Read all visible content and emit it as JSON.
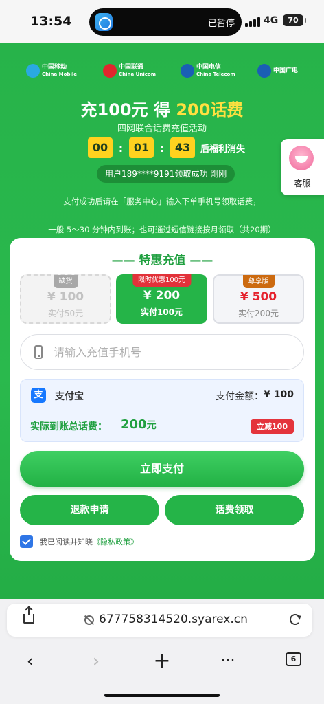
{
  "status_bar": {
    "time": "13:54",
    "island_text": "已暂停",
    "network": "4G",
    "battery": "70"
  },
  "carriers": [
    {
      "name": "中国移动",
      "sub": "China Mobile",
      "color": "#2aa9e0"
    },
    {
      "name": "中国联通",
      "sub": "China Unicom",
      "color": "#e0262d"
    },
    {
      "name": "中国电信",
      "sub": "China Telecom",
      "color": "#1a5fb4"
    },
    {
      "name": "中国广电",
      "sub": "",
      "color": "#1a5fb4"
    }
  ],
  "hero": {
    "headline_prefix": "充100元 得 ",
    "headline_highlight": "200话费",
    "subtitle": "—— 四网联合话费充值活动 ——",
    "countdown": [
      "00",
      "01",
      "43"
    ],
    "countdown_sep": ":",
    "countdown_label": "后福利消失",
    "winner": "用户189****9191领取成功 刚刚",
    "notice1": "支付成功后请在「服务中心」输入下单手机号领取话费，",
    "notice2": "一般 5～30 分钟内到账；也可通过短信链接按月领取（共20期）"
  },
  "side": {
    "service_label": "客服"
  },
  "card": {
    "title": "—— 特惠充值 ——",
    "options": [
      {
        "tag": "缺货",
        "price": "¥ 100",
        "sub": "实付50元"
      },
      {
        "tag": "限时优惠100元",
        "price": "¥ 200",
        "sub": "实付100元"
      },
      {
        "tag": "尊享版",
        "price": "¥ 500",
        "sub": "实付200元"
      }
    ],
    "phone_placeholder": "请输入充值手机号",
    "payment": {
      "method": "支付宝",
      "method_icon_text": "支",
      "amount_label": "支付金额：",
      "amount": "¥ 100",
      "actual_label": "实际到账总话费：",
      "actual_amount": "200",
      "actual_unit": "元",
      "discount": "立减100"
    },
    "pay_button": "立即支付",
    "refund_button": "退款申请",
    "claim_button": "话费领取",
    "agree_text": "我已阅读并知晓",
    "agree_link": "《隐私政策》"
  },
  "browser": {
    "url": "677758314520.syarex.cn",
    "tab_count": "6",
    "back": "‹",
    "forward": "›",
    "add": "+",
    "more": "···"
  },
  "colors": {
    "brand_green": "#25b448",
    "accent_yellow": "#ffd21f",
    "alert_red": "#e4343c"
  }
}
